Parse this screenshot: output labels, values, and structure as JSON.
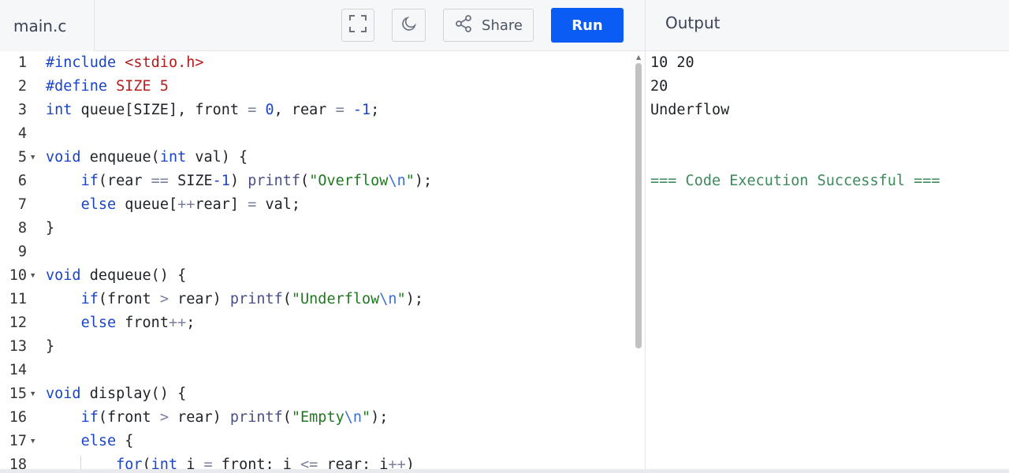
{
  "header": {
    "file_tab": "main.c",
    "share_label": "Share",
    "run_label": "Run",
    "output_title": "Output"
  },
  "icons": [
    "fullscreen-icon",
    "moon-icon",
    "share-icon",
    "fold-arrow-icon"
  ],
  "colors": {
    "run_button": "#0a5cf5",
    "keyword": "#1a45c9",
    "macro": "#b71c1c",
    "string": "#1f7a1f",
    "success_text": "#3d8a5c"
  },
  "editor": {
    "lines": [
      {
        "num": "1",
        "fold": false,
        "tokens": [
          {
            "t": "#include ",
            "c": "kw"
          },
          {
            "t": "<stdio.h>",
            "c": "mac"
          }
        ]
      },
      {
        "num": "2",
        "fold": false,
        "tokens": [
          {
            "t": "#define ",
            "c": "kw"
          },
          {
            "t": "SIZE 5",
            "c": "mac"
          }
        ]
      },
      {
        "num": "3",
        "fold": false,
        "tokens": [
          {
            "t": "int",
            "c": "kw"
          },
          {
            "t": " queue[SIZE], front ",
            "c": ""
          },
          {
            "t": "=",
            "c": "op"
          },
          {
            "t": " ",
            "c": ""
          },
          {
            "t": "0",
            "c": "num"
          },
          {
            "t": ", rear ",
            "c": ""
          },
          {
            "t": "=",
            "c": "op"
          },
          {
            "t": " ",
            "c": ""
          },
          {
            "t": "-1",
            "c": "num"
          },
          {
            "t": ";",
            "c": ""
          }
        ]
      },
      {
        "num": "4",
        "fold": false,
        "tokens": []
      },
      {
        "num": "5",
        "fold": true,
        "tokens": [
          {
            "t": "void",
            "c": "kw"
          },
          {
            "t": " enqueue(",
            "c": ""
          },
          {
            "t": "int",
            "c": "kw"
          },
          {
            "t": " val) {",
            "c": ""
          }
        ]
      },
      {
        "num": "6",
        "fold": false,
        "tokens": [
          {
            "t": "    ",
            "c": ""
          },
          {
            "t": "if",
            "c": "kw"
          },
          {
            "t": "(rear ",
            "c": ""
          },
          {
            "t": "==",
            "c": "op"
          },
          {
            "t": " SIZE",
            "c": ""
          },
          {
            "t": "-1",
            "c": "num"
          },
          {
            "t": ") ",
            "c": ""
          },
          {
            "t": "printf",
            "c": "fn"
          },
          {
            "t": "(",
            "c": ""
          },
          {
            "t": "\"Overflow",
            "c": "str"
          },
          {
            "t": "\\n",
            "c": "esc"
          },
          {
            "t": "\"",
            "c": "str"
          },
          {
            "t": ");",
            "c": ""
          }
        ]
      },
      {
        "num": "7",
        "fold": false,
        "tokens": [
          {
            "t": "    ",
            "c": ""
          },
          {
            "t": "else",
            "c": "kw"
          },
          {
            "t": " queue[",
            "c": ""
          },
          {
            "t": "++",
            "c": "op"
          },
          {
            "t": "rear] ",
            "c": ""
          },
          {
            "t": "=",
            "c": "op"
          },
          {
            "t": " val;",
            "c": ""
          }
        ]
      },
      {
        "num": "8",
        "fold": false,
        "tokens": [
          {
            "t": "}",
            "c": ""
          }
        ]
      },
      {
        "num": "9",
        "fold": false,
        "tokens": []
      },
      {
        "num": "10",
        "fold": true,
        "tokens": [
          {
            "t": "void",
            "c": "kw"
          },
          {
            "t": " dequeue() {",
            "c": ""
          }
        ]
      },
      {
        "num": "11",
        "fold": false,
        "tokens": [
          {
            "t": "    ",
            "c": ""
          },
          {
            "t": "if",
            "c": "kw"
          },
          {
            "t": "(front ",
            "c": ""
          },
          {
            "t": ">",
            "c": "op"
          },
          {
            "t": " rear) ",
            "c": ""
          },
          {
            "t": "printf",
            "c": "fn"
          },
          {
            "t": "(",
            "c": ""
          },
          {
            "t": "\"Underflow",
            "c": "str"
          },
          {
            "t": "\\n",
            "c": "esc"
          },
          {
            "t": "\"",
            "c": "str"
          },
          {
            "t": ");",
            "c": ""
          }
        ]
      },
      {
        "num": "12",
        "fold": false,
        "tokens": [
          {
            "t": "    ",
            "c": ""
          },
          {
            "t": "else",
            "c": "kw"
          },
          {
            "t": " front",
            "c": ""
          },
          {
            "t": "++",
            "c": "op"
          },
          {
            "t": ";",
            "c": ""
          }
        ]
      },
      {
        "num": "13",
        "fold": false,
        "tokens": [
          {
            "t": "}",
            "c": ""
          }
        ]
      },
      {
        "num": "14",
        "fold": false,
        "tokens": []
      },
      {
        "num": "15",
        "fold": true,
        "tokens": [
          {
            "t": "void",
            "c": "kw"
          },
          {
            "t": " display() {",
            "c": ""
          }
        ]
      },
      {
        "num": "16",
        "fold": false,
        "tokens": [
          {
            "t": "    ",
            "c": ""
          },
          {
            "t": "if",
            "c": "kw"
          },
          {
            "t": "(front ",
            "c": ""
          },
          {
            "t": ">",
            "c": "op"
          },
          {
            "t": " rear) ",
            "c": ""
          },
          {
            "t": "printf",
            "c": "fn"
          },
          {
            "t": "(",
            "c": ""
          },
          {
            "t": "\"Empty",
            "c": "str"
          },
          {
            "t": "\\n",
            "c": "esc"
          },
          {
            "t": "\"",
            "c": "str"
          },
          {
            "t": ");",
            "c": ""
          }
        ]
      },
      {
        "num": "17",
        "fold": true,
        "tokens": [
          {
            "t": "    ",
            "c": ""
          },
          {
            "t": "else",
            "c": "kw"
          },
          {
            "t": " {",
            "c": ""
          }
        ]
      },
      {
        "num": "18",
        "fold": false,
        "tokens": [
          {
            "t": "        ",
            "c": ""
          },
          {
            "t": "for",
            "c": "kw"
          },
          {
            "t": "(",
            "c": ""
          },
          {
            "t": "int",
            "c": "kw"
          },
          {
            "t": " i ",
            "c": ""
          },
          {
            "t": "=",
            "c": "op"
          },
          {
            "t": " front; i ",
            "c": ""
          },
          {
            "t": "<=",
            "c": "op"
          },
          {
            "t": " rear; i",
            "c": ""
          },
          {
            "t": "++",
            "c": "op"
          },
          {
            "t": ")",
            "c": ""
          }
        ]
      }
    ]
  },
  "output": {
    "lines": [
      "10 20",
      "20",
      "Underflow",
      "",
      "",
      "=== Code Execution Successful ==="
    ]
  }
}
